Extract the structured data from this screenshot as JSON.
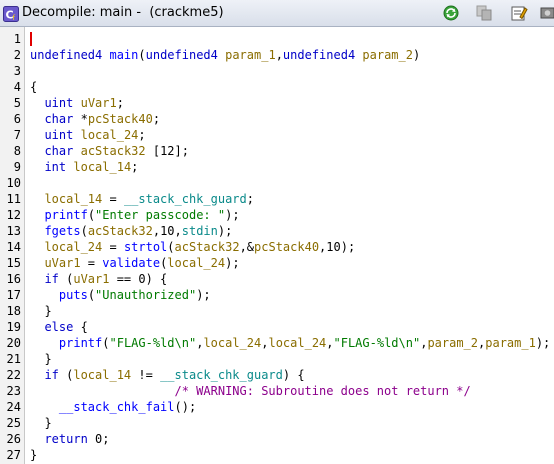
{
  "window": {
    "title": "Decompile: main -  (crackme5)"
  },
  "toolbar": {
    "buttons": [
      {
        "name": "refresh-button",
        "icon": "refresh-icon"
      },
      {
        "name": "copy-button",
        "icon": "copy-icon"
      },
      {
        "name": "edit-function-signature-button",
        "icon": "edit-icon"
      },
      {
        "name": "snapshot-button",
        "icon": "snapshot-icon"
      }
    ]
  },
  "colors": {
    "keyword": "#0000c8",
    "variable": "#8a6d00",
    "function": "#0000ff",
    "global": "#0a8a8a",
    "string": "#007a00",
    "comment": "#8c008c",
    "cursor": "#e00000"
  },
  "lines": [
    {
      "n": "1",
      "tokens": []
    },
    {
      "n": "2",
      "tokens": [
        [
          "kw",
          "undefined4"
        ],
        [
          "p",
          " "
        ],
        [
          "fn",
          "main"
        ],
        [
          "p",
          "("
        ],
        [
          "kw",
          "undefined4"
        ],
        [
          "p",
          " "
        ],
        [
          "vr",
          "param_1"
        ],
        [
          "p",
          ","
        ],
        [
          "kw",
          "undefined4"
        ],
        [
          "p",
          " "
        ],
        [
          "vr",
          "param_2"
        ],
        [
          "p",
          ")"
        ]
      ]
    },
    {
      "n": "3",
      "tokens": []
    },
    {
      "n": "4",
      "tokens": [
        [
          "p",
          "{"
        ]
      ]
    },
    {
      "n": "5",
      "tokens": [
        [
          "p",
          "  "
        ],
        [
          "kw",
          "uint"
        ],
        [
          "p",
          " "
        ],
        [
          "vr",
          "uVar1"
        ],
        [
          "p",
          ";"
        ]
      ]
    },
    {
      "n": "6",
      "tokens": [
        [
          "p",
          "  "
        ],
        [
          "kw",
          "char"
        ],
        [
          "p",
          " *"
        ],
        [
          "vr",
          "pcStack40"
        ],
        [
          "p",
          ";"
        ]
      ]
    },
    {
      "n": "7",
      "tokens": [
        [
          "p",
          "  "
        ],
        [
          "kw",
          "uint"
        ],
        [
          "p",
          " "
        ],
        [
          "vr",
          "local_24"
        ],
        [
          "p",
          ";"
        ]
      ]
    },
    {
      "n": "8",
      "tokens": [
        [
          "p",
          "  "
        ],
        [
          "kw",
          "char"
        ],
        [
          "p",
          " "
        ],
        [
          "vr",
          "acStack32"
        ],
        [
          "p",
          " [12];"
        ]
      ]
    },
    {
      "n": "9",
      "tokens": [
        [
          "p",
          "  "
        ],
        [
          "kw",
          "int"
        ],
        [
          "p",
          " "
        ],
        [
          "vr",
          "local_14"
        ],
        [
          "p",
          ";"
        ]
      ]
    },
    {
      "n": "10",
      "tokens": [
        [
          "p",
          "  "
        ]
      ]
    },
    {
      "n": "11",
      "tokens": [
        [
          "p",
          "  "
        ],
        [
          "vr",
          "local_14"
        ],
        [
          "p",
          " = "
        ],
        [
          "glb",
          "__stack_chk_guard"
        ],
        [
          "p",
          ";"
        ]
      ]
    },
    {
      "n": "12",
      "tokens": [
        [
          "p",
          "  "
        ],
        [
          "fn",
          "printf"
        ],
        [
          "p",
          "("
        ],
        [
          "str",
          "\"Enter passcode: \""
        ],
        [
          "p",
          ");"
        ]
      ]
    },
    {
      "n": "13",
      "tokens": [
        [
          "p",
          "  "
        ],
        [
          "fn",
          "fgets"
        ],
        [
          "p",
          "("
        ],
        [
          "vr",
          "acStack32"
        ],
        [
          "p",
          ",10,"
        ],
        [
          "glb",
          "stdin"
        ],
        [
          "p",
          ");"
        ]
      ]
    },
    {
      "n": "14",
      "tokens": [
        [
          "p",
          "  "
        ],
        [
          "vr",
          "local_24"
        ],
        [
          "p",
          " = "
        ],
        [
          "fn",
          "strtol"
        ],
        [
          "p",
          "("
        ],
        [
          "vr",
          "acStack32"
        ],
        [
          "p",
          ",&"
        ],
        [
          "vr",
          "pcStack40"
        ],
        [
          "p",
          ",10);"
        ]
      ]
    },
    {
      "n": "15",
      "tokens": [
        [
          "p",
          "  "
        ],
        [
          "vr",
          "uVar1"
        ],
        [
          "p",
          " = "
        ],
        [
          "fn",
          "validate"
        ],
        [
          "p",
          "("
        ],
        [
          "vr",
          "local_24"
        ],
        [
          "p",
          ");"
        ]
      ]
    },
    {
      "n": "16",
      "tokens": [
        [
          "p",
          "  "
        ],
        [
          "kw",
          "if"
        ],
        [
          "p",
          " ("
        ],
        [
          "vr",
          "uVar1"
        ],
        [
          "p",
          " == 0) {"
        ]
      ]
    },
    {
      "n": "17",
      "tokens": [
        [
          "p",
          "    "
        ],
        [
          "fn",
          "puts"
        ],
        [
          "p",
          "("
        ],
        [
          "str",
          "\"Unauthorized\""
        ],
        [
          "p",
          ");"
        ]
      ]
    },
    {
      "n": "18",
      "tokens": [
        [
          "p",
          "  }"
        ]
      ]
    },
    {
      "n": "19",
      "tokens": [
        [
          "p",
          "  "
        ],
        [
          "kw",
          "else"
        ],
        [
          "p",
          " {"
        ]
      ]
    },
    {
      "n": "20",
      "tokens": [
        [
          "p",
          "    "
        ],
        [
          "fn",
          "printf"
        ],
        [
          "p",
          "("
        ],
        [
          "str",
          "\"FLAG-%ld\\n\""
        ],
        [
          "p",
          ","
        ],
        [
          "vr",
          "local_24"
        ],
        [
          "p",
          ","
        ],
        [
          "vr",
          "local_24"
        ],
        [
          "p",
          ","
        ],
        [
          "str",
          "\"FLAG-%ld\\n\""
        ],
        [
          "p",
          ","
        ],
        [
          "vr",
          "param_2"
        ],
        [
          "p",
          ","
        ],
        [
          "vr",
          "param_1"
        ],
        [
          "p",
          ");"
        ]
      ]
    },
    {
      "n": "21",
      "tokens": [
        [
          "p",
          "  }"
        ]
      ]
    },
    {
      "n": "22",
      "tokens": [
        [
          "p",
          "  "
        ],
        [
          "kw",
          "if"
        ],
        [
          "p",
          " ("
        ],
        [
          "vr",
          "local_14"
        ],
        [
          "p",
          " != "
        ],
        [
          "glb",
          "__stack_chk_guard"
        ],
        [
          "p",
          ") {"
        ]
      ]
    },
    {
      "n": "23",
      "tokens": [
        [
          "p",
          "                    "
        ],
        [
          "cm",
          "/* WARNING: Subroutine does not return */"
        ]
      ]
    },
    {
      "n": "24",
      "tokens": [
        [
          "p",
          "    "
        ],
        [
          "fn",
          "__stack_chk_fail"
        ],
        [
          "p",
          "();"
        ]
      ]
    },
    {
      "n": "25",
      "tokens": [
        [
          "p",
          "  }"
        ]
      ]
    },
    {
      "n": "26",
      "tokens": [
        [
          "p",
          "  "
        ],
        [
          "kw",
          "return"
        ],
        [
          "p",
          " 0;"
        ]
      ]
    },
    {
      "n": "27",
      "tokens": [
        [
          "p",
          "}"
        ]
      ]
    }
  ]
}
